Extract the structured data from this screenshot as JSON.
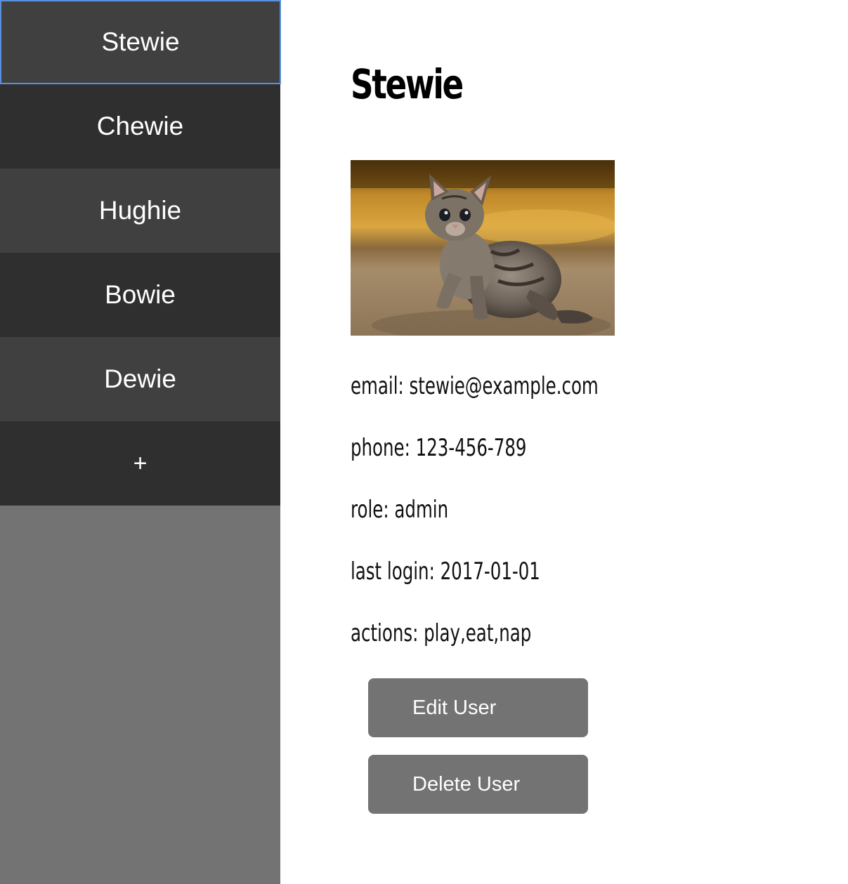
{
  "sidebar": {
    "items": [
      {
        "label": "Stewie"
      },
      {
        "label": "Chewie"
      },
      {
        "label": "Hughie"
      },
      {
        "label": "Bowie"
      },
      {
        "label": "Dewie"
      }
    ],
    "add_label": "+"
  },
  "user": {
    "name": "Stewie",
    "photo_icon": "kitten-photo",
    "fields": {
      "email": {
        "label": "email:",
        "value": "stewie@example.com"
      },
      "phone": {
        "label": "phone:",
        "value": "123-456-789"
      },
      "role": {
        "label": "role:",
        "value": "admin"
      },
      "last_login": {
        "label": "last login:",
        "value": "2017-01-01"
      },
      "actions": {
        "label": "actions:",
        "value": "play,eat,nap"
      }
    }
  },
  "buttons": {
    "edit_label": "Edit User",
    "delete_label": "Delete User"
  },
  "colors": {
    "sidebar_bg": "#737373",
    "item_light": "#404040",
    "item_dark": "#2f2f2f",
    "active_border": "#5b8fe0",
    "button_bg": "#737373"
  }
}
